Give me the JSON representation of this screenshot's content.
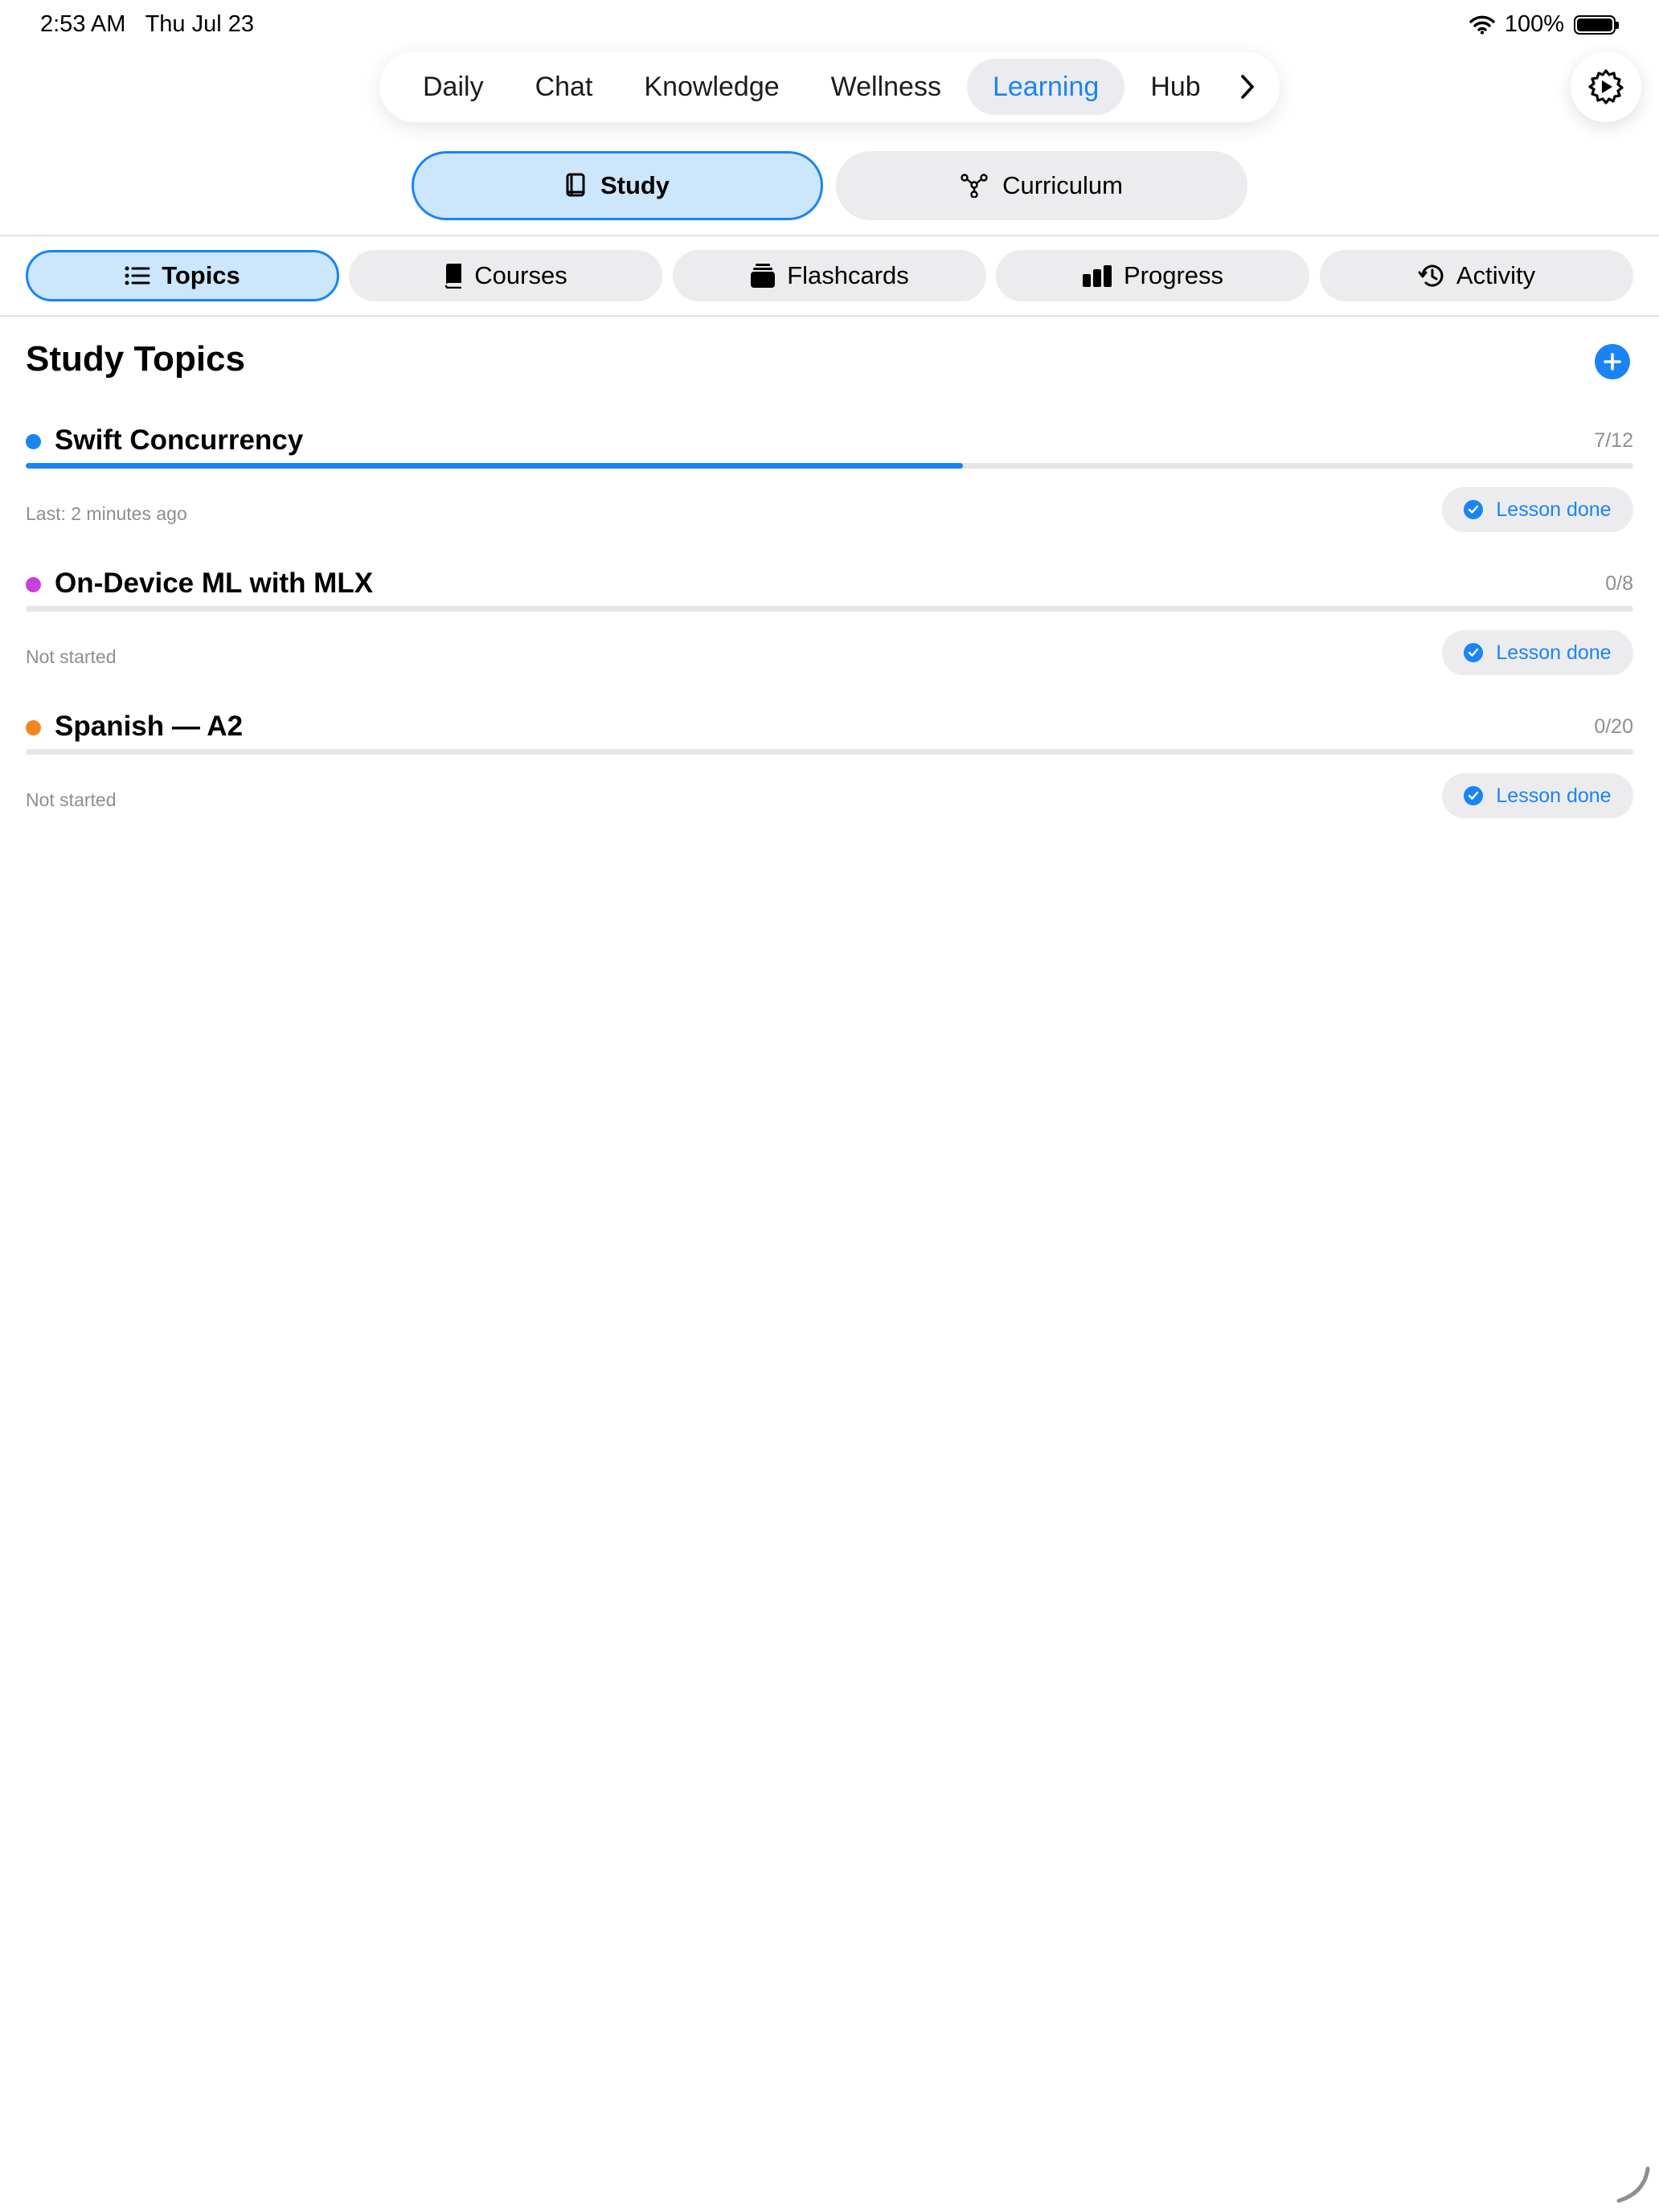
{
  "status_bar": {
    "time": "2:53 AM",
    "date": "Thu Jul 23",
    "battery": "100%",
    "battery_level": 1.0,
    "icons": [
      "wifi-icon",
      "battery-icon"
    ]
  },
  "top_nav": {
    "items": [
      {
        "label": "Daily"
      },
      {
        "label": "Chat"
      },
      {
        "label": "Knowledge"
      },
      {
        "label": "Wellness"
      },
      {
        "label": "Learning",
        "active": true
      },
      {
        "label": "Hub"
      }
    ],
    "more_icon": "chevron-right-icon",
    "settings_icon": "gear-icon"
  },
  "segmented": {
    "study": {
      "label": "Study",
      "icon": "book-icon",
      "active": true
    },
    "curriculum": {
      "label": "Curriculum",
      "icon": "graph-nodes-icon"
    }
  },
  "sub_tabs": [
    {
      "label": "Topics",
      "icon": "list-icon",
      "active": true
    },
    {
      "label": "Courses",
      "icon": "book-closed-icon"
    },
    {
      "label": "Flashcards",
      "icon": "card-stack-icon"
    },
    {
      "label": "Progress",
      "icon": "bar-chart-icon"
    },
    {
      "label": "Activity",
      "icon": "history-icon"
    }
  ],
  "section": {
    "title": "Study Topics",
    "add_icon": "plus-icon"
  },
  "topics": [
    {
      "name": "Swift Concurrency",
      "color": "#1a84f5",
      "count": "7/12",
      "progress": 0.583,
      "status": "Last: 2 minutes ago",
      "action": "Lesson done"
    },
    {
      "name": "On-Device ML with MLX",
      "color": "#c840e0",
      "count": "0/8",
      "progress": 0,
      "status": "Not started",
      "action": "Lesson done"
    },
    {
      "name": "Spanish — A2",
      "color": "#f5861f",
      "count": "0/20",
      "progress": 0,
      "status": "Not started",
      "action": "Lesson done"
    }
  ],
  "colors": {
    "accent": "#1a84f5",
    "accent_soft": "#cce6fb",
    "pill_bg": "#ececef",
    "secondary_text": "#8e8e93"
  }
}
